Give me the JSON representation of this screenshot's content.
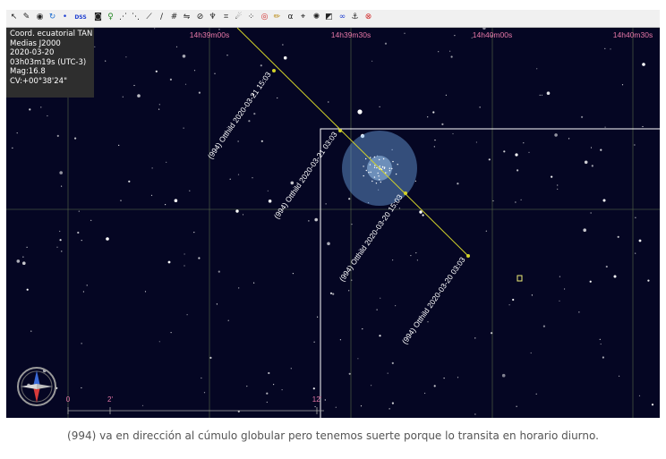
{
  "toolbar": {
    "icons": [
      {
        "name": "pointer-tool-icon",
        "glyph": "↖",
        "color": "#222222"
      },
      {
        "name": "pin-tool-icon",
        "glyph": "✎",
        "color": "#222222"
      },
      {
        "name": "marker-tool-icon",
        "glyph": "◉",
        "color": "#222222"
      },
      {
        "name": "refresh-icon",
        "glyph": "↻",
        "color": "#1f6fd1"
      },
      {
        "name": "dot-icon",
        "glyph": "•",
        "color": "#1f3fd1"
      },
      {
        "name": "dss-label",
        "glyph": "DSS",
        "color": "#1f3fd1"
      },
      {
        "name": "camera-icon",
        "glyph": "◙",
        "color": "#222222"
      },
      {
        "name": "bulb-icon",
        "glyph": "♀",
        "color": "#2a8a2a"
      },
      {
        "name": "constellation-lines-icon",
        "glyph": "⋰",
        "color": "#222222"
      },
      {
        "name": "asterism-icon",
        "glyph": "⋱",
        "color": "#222222"
      },
      {
        "name": "measure-icon",
        "glyph": "⟋",
        "color": "#222222"
      },
      {
        "name": "ruler-icon",
        "glyph": "∕",
        "color": "#222222"
      },
      {
        "name": "grid-icon",
        "glyph": "#",
        "color": "#222222"
      },
      {
        "name": "flip-icon",
        "glyph": "⇋",
        "color": "#222222"
      },
      {
        "name": "circle-slash-icon",
        "glyph": "⊘",
        "color": "#222222"
      },
      {
        "name": "telescope-icon",
        "glyph": "♆",
        "color": "#222222"
      },
      {
        "name": "frame-icon",
        "glyph": "⌗",
        "color": "#222222"
      },
      {
        "name": "comet-icon",
        "glyph": "☄",
        "color": "#222222"
      },
      {
        "name": "dots-icon",
        "glyph": "⁘",
        "color": "#222222"
      },
      {
        "name": "target-icon",
        "glyph": "◎",
        "color": "#d12a2a"
      },
      {
        "name": "pencil-icon",
        "glyph": "✏",
        "color": "#b8860b"
      },
      {
        "name": "alpha-icon",
        "glyph": "α",
        "color": "#222222"
      },
      {
        "name": "fov-icon",
        "glyph": "⌖",
        "color": "#222222"
      },
      {
        "name": "galaxy-icon",
        "glyph": "✺",
        "color": "#222222"
      },
      {
        "name": "contrast-icon",
        "glyph": "◩",
        "color": "#222222"
      },
      {
        "name": "link-icon",
        "glyph": "∞",
        "color": "#1f3fd1"
      },
      {
        "name": "anchor-icon",
        "glyph": "⚓",
        "color": "#222222"
      },
      {
        "name": "no-target-icon",
        "glyph": "⊗",
        "color": "#d12a2a"
      }
    ]
  },
  "info": {
    "lines": [
      "Coord. ecuatorial TAN",
      "Medias J2000",
      "2020-03-20",
      "03h03m19s (UTC-3)",
      "Mag:16.8",
      "CV:+00°38'24\""
    ]
  },
  "axis": {
    "ra_labels": [
      "14h39m00s",
      "14h39m30s",
      "14h40m00s",
      "14h40m30s"
    ]
  },
  "scale": {
    "labels": [
      "0",
      "2'",
      "12'"
    ]
  },
  "track": {
    "object": "(994) Otthild",
    "points": [
      {
        "date": "2020-03-21 15:03",
        "label": "(994) Otthild 2020-03-21 15:03"
      },
      {
        "date": "2020-03-21 03:03",
        "label": "(994) Otthild 2020-03-21 03:03"
      },
      {
        "date": "2020-03-20 15:03",
        "label": "(994) Otthild 2020-03-20 15:03"
      },
      {
        "date": "2020-03-20 03:03",
        "label": "(994) Otthild 2020-03-20 03:03"
      }
    ]
  },
  "colors": {
    "sky": "#050623",
    "grid": "#5a6a4a",
    "track": "#d2d22a",
    "axis_label": "#e878a8",
    "cluster": "#6ea6e6",
    "field": "#ffffff"
  },
  "caption": "(994) va en dirección al cúmulo globular pero tenemos suerte porque lo transita en horario diurno."
}
